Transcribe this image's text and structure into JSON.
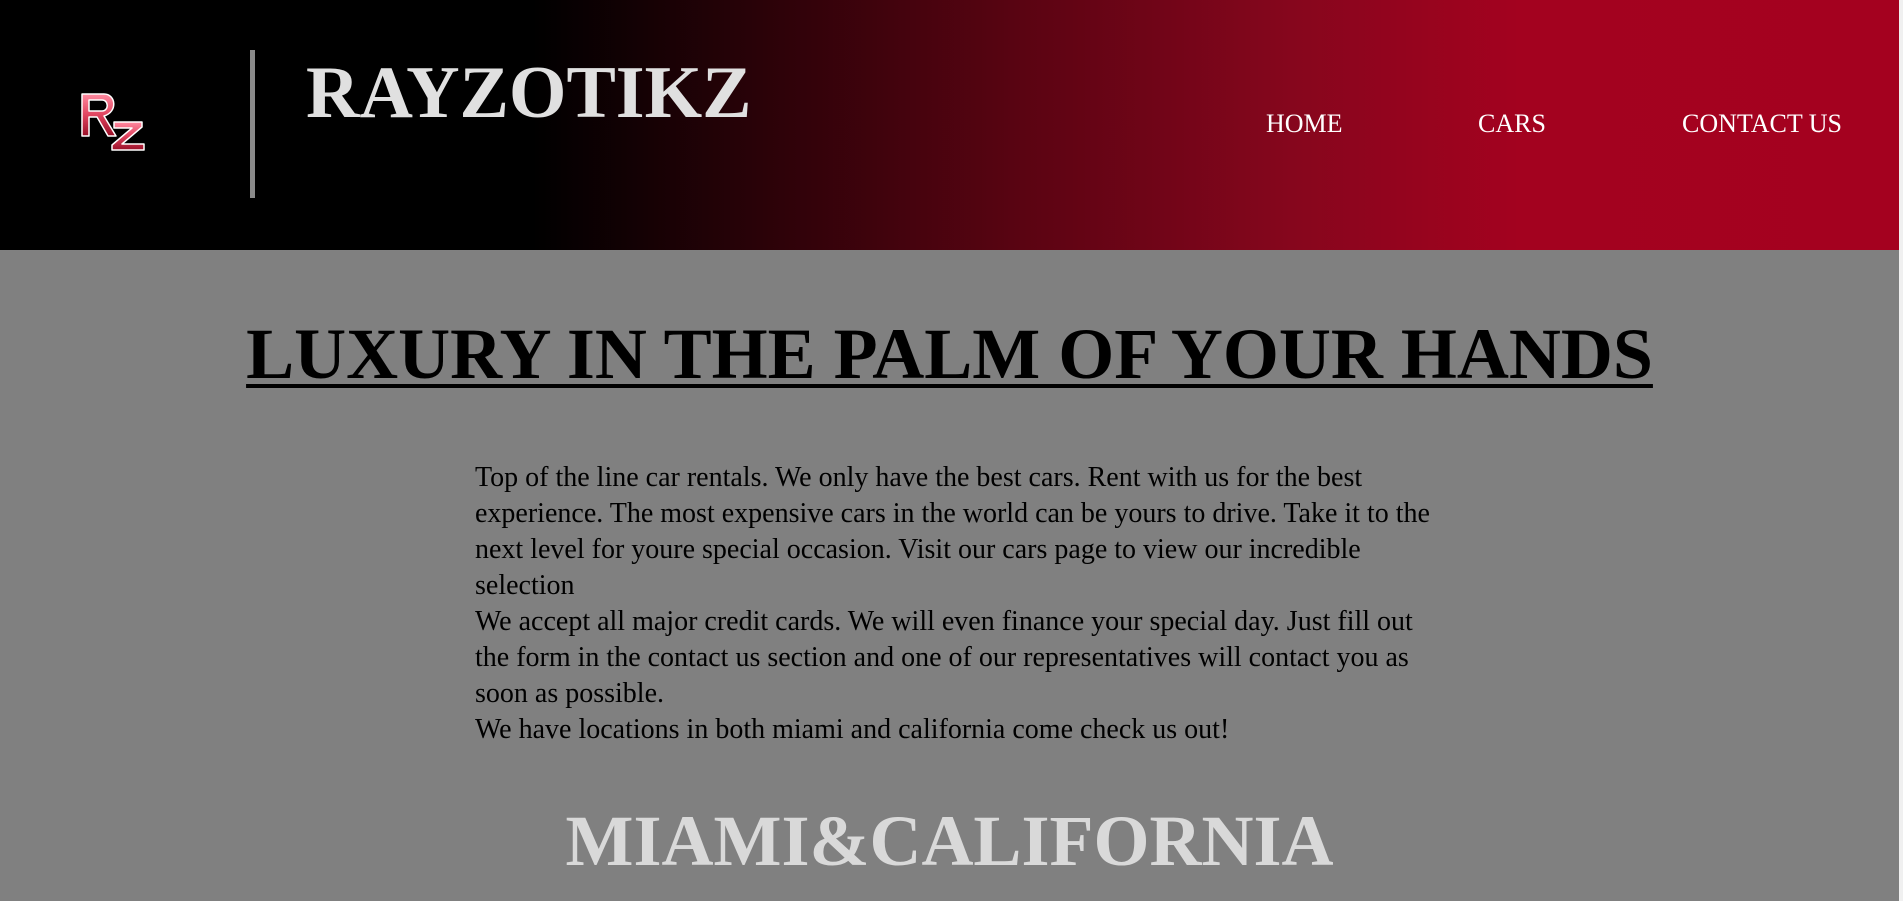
{
  "header": {
    "brand": "RAYZOTIKZ",
    "logo_text": "RZ",
    "logo_icon": "rz-logo-icon",
    "gradient_start": "#000000",
    "gradient_end": "#a4011f"
  },
  "nav": {
    "items": [
      {
        "label": "HOME"
      },
      {
        "label": "CARS"
      },
      {
        "label": "CONTACT US"
      }
    ]
  },
  "main": {
    "title": "LUXURY IN THE PALM OF YOUR HANDS",
    "paragraphs": [
      "Top of the line car rentals. We only have the best cars. Rent with us for the best experience. The most expensive cars in the world can be yours to drive. Take it to the next level for youre special occasion. Visit our cars page to view our incredible selection",
      "We accept all major credit cards. We will even finance your special day. Just fill out the form in the contact us section and one of our representatives will contact you as soon as possible.",
      "We have locations in both miami and california come check us out!"
    ],
    "locations_heading": "MIAMI&CALIFORNIA"
  },
  "colors": {
    "page_background": "#808080",
    "accent_red": "#a4011f",
    "logo_pink": "#e0445f"
  }
}
